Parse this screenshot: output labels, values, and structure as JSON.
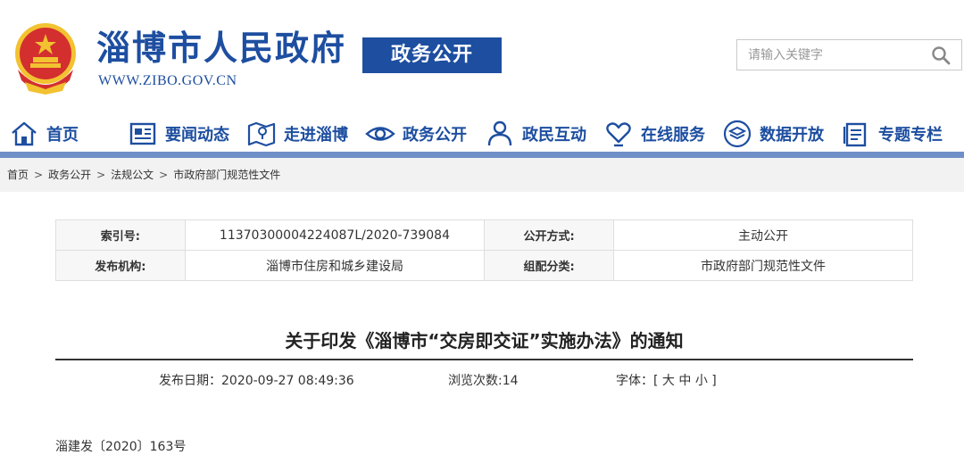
{
  "header": {
    "site_title": "淄博市人民政府",
    "site_url": "WWW.ZIBO.GOV.CN",
    "section_badge": "政务公开",
    "search": {
      "placeholder": "请输入关键字",
      "value": ""
    }
  },
  "nav": {
    "items": [
      {
        "label": "首页",
        "icon": "home-icon"
      },
      {
        "label": "要闻动态",
        "icon": "news-icon"
      },
      {
        "label": "走进淄博",
        "icon": "map-icon"
      },
      {
        "label": "政务公开",
        "icon": "eye-icon"
      },
      {
        "label": "政民互动",
        "icon": "people-icon"
      },
      {
        "label": "在线服务",
        "icon": "heart-hand-icon"
      },
      {
        "label": "数据开放",
        "icon": "layers-icon"
      },
      {
        "label": "专题专栏",
        "icon": "document-icon"
      }
    ]
  },
  "breadcrumb": [
    "首页",
    "政务公开",
    "法规公文",
    "市政府部门规范性文件"
  ],
  "info": {
    "index_label": "索引号:",
    "index_value": "11370300004224087L/2020-739084",
    "disclosure_label": "公开方式:",
    "disclosure_value": "主动公开",
    "publisher_label": "发布机构:",
    "publisher_value": "淄博市住房和城乡建设局",
    "category_label": "组配分类:",
    "category_value": "市政府部门规范性文件"
  },
  "document": {
    "title": "关于印发《淄博市“交房即交证”实施办法》的通知",
    "publish_label": "发布日期：",
    "publish_date": "2020-09-27 08:49:36",
    "views_label": "浏览次数:",
    "views": "14",
    "font_label": "字体：",
    "font_open": "[",
    "font_large": "大",
    "font_medium": "中",
    "font_small": "小",
    "font_close": "]",
    "doc_number": "淄建发〔2020〕163号"
  },
  "colors": {
    "brand_blue": "#1d4ea0",
    "emblem_red": "#d32f2f",
    "emblem_gold": "#f2c230",
    "nav_bar": "#6f8fc7"
  }
}
